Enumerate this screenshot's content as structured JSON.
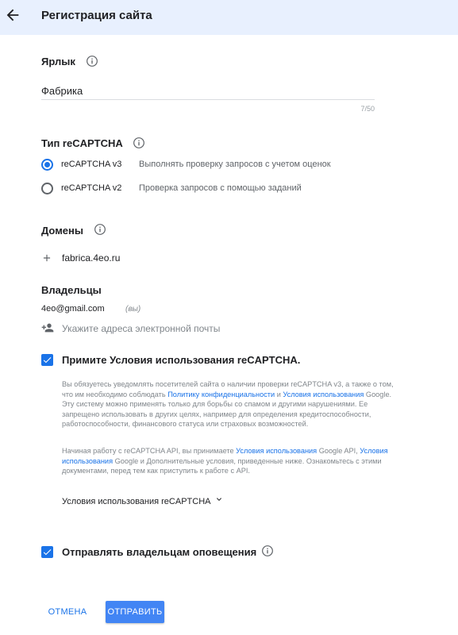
{
  "header": {
    "title": "Регистрация сайта",
    "back_icon": "arrow-back-icon"
  },
  "label_section": {
    "title": "Ярлык",
    "value": "Фабрика",
    "counter": "7/50"
  },
  "type_section": {
    "title": "Тип reCAPTCHA",
    "options": [
      {
        "label": "reCAPTCHA v3",
        "description": "Выполнять проверку запросов с учетом оценок",
        "checked": true
      },
      {
        "label": "reCAPTCHA v2",
        "description": "Проверка запросов с помощью заданий",
        "checked": false
      }
    ]
  },
  "domains_section": {
    "title": "Домены",
    "domain": "fabrica.4eo.ru"
  },
  "owners_section": {
    "title": "Владельцы",
    "owner_email": "4eo@gmail.com",
    "owner_you": "(вы)",
    "email_placeholder": "Укажите адреса электронной почты"
  },
  "terms": {
    "checkbox_label": "Примите Условия использования reCAPTCHA.",
    "p1_a": "Вы обязуетесь уведомлять посетителей сайта о наличии проверки reCAPTCHA v3, а также о том, что им необходимо соблюдать ",
    "p1_link1": "Политику конфиденциальности",
    "p1_b": " и ",
    "p1_link2": "Условия использования",
    "p1_c": " Google. Эту систему можно применять только для борьбы со спамом и другими нарушениями. Ее запрещено использовать в других целях, например для определения кредитоспособности, работоспособности, финансового статуса или страховых возможностей.",
    "p2_a": "Начиная работу с reCAPTCHA API, вы принимаете ",
    "p2_link1": "Условия использования",
    "p2_b": " Google API, ",
    "p2_link2": "Условия использования",
    "p2_c": " Google и Дополнительные условия, приведенные ниже. Ознакомьтесь с этими документами, перед тем как приступить к работе с API.",
    "dropdown_label": "Условия использования reCAPTCHA"
  },
  "alerts": {
    "checkbox_label": "Отправлять владельцам оповещения"
  },
  "actions": {
    "cancel": "ОТМЕНА",
    "submit": "ОТПРАВИТЬ"
  },
  "colors": {
    "accent": "#1a73e8",
    "header_bg": "#e8f0fe",
    "submit_bg": "#4285f4"
  }
}
